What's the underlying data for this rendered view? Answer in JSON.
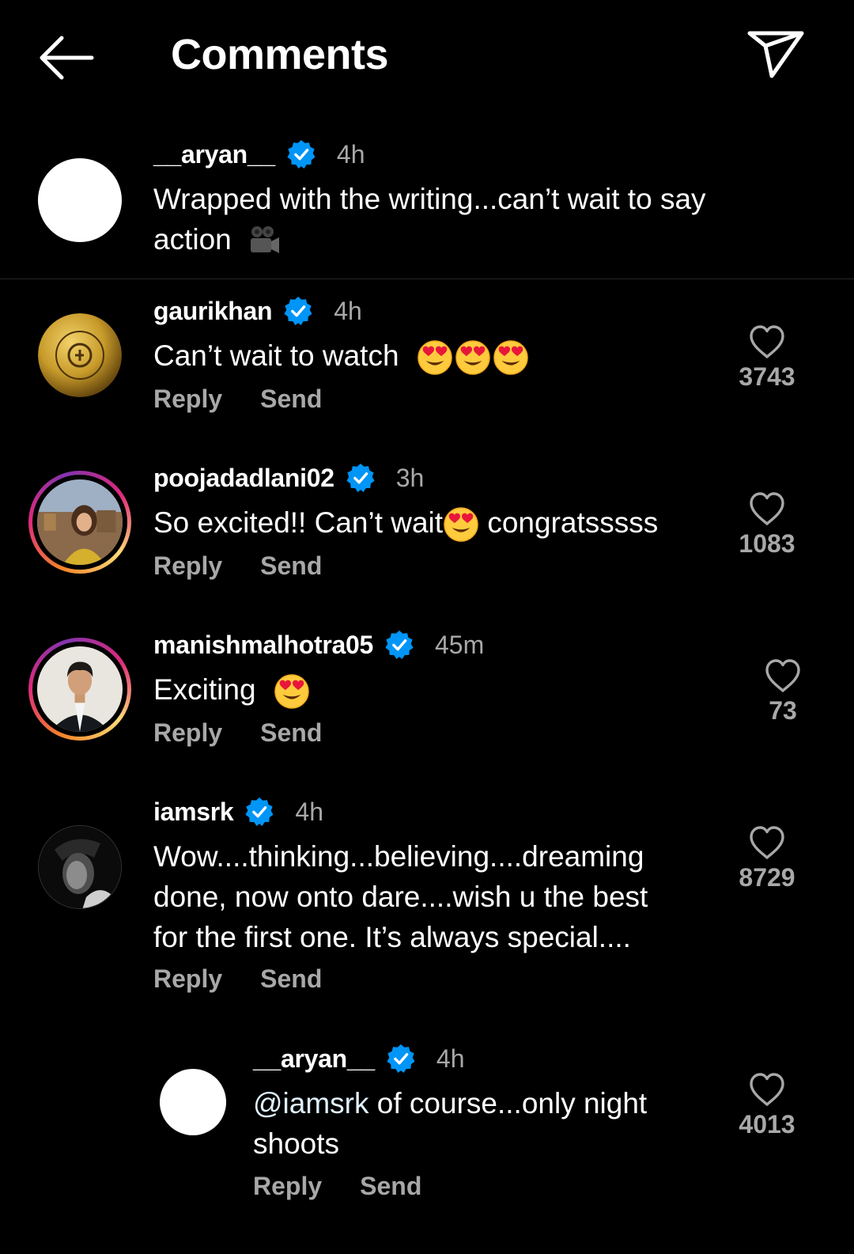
{
  "header": {
    "title": "Comments"
  },
  "caption": {
    "username": "__aryan__",
    "time": "4h",
    "text_line1": "Wrapped with the writing...can’t wait to say",
    "text_line2": "action"
  },
  "comments": [
    {
      "username": "gaurikhan",
      "time": "4h",
      "text": "Can’t wait to watch",
      "reply_label": "Reply",
      "send_label": "Send",
      "likes": "3743"
    },
    {
      "username": "poojadadlani02",
      "time": "3h",
      "text_before": "So excited!! Can’t wait",
      "text_after": " congratsssss",
      "reply_label": "Reply",
      "send_label": "Send",
      "likes": "1083"
    },
    {
      "username": "manishmalhotra05",
      "time": "45m",
      "text": "Exciting",
      "reply_label": "Reply",
      "send_label": "Send",
      "likes": "73"
    },
    {
      "username": "iamsrk",
      "time": "4h",
      "text_line1": "Wow....thinking...believing....dreaming",
      "text_line2": "done, now onto dare....wish u the best",
      "text_line3": "for the first one. It’s always special....",
      "reply_label": "Reply",
      "send_label": "Send",
      "likes": "8729"
    },
    {
      "username": "__aryan__",
      "time": "4h",
      "mention": "@iamsrk",
      "text_rest": " of course...only night",
      "text_line2": "shoots",
      "reply_label": "Reply",
      "send_label": "Send",
      "likes": "4013"
    }
  ],
  "icons": {
    "back": "arrow-left-icon",
    "send": "paper-plane-icon",
    "verified": "verified-badge-icon",
    "like": "heart-outline-icon",
    "emoji_heart_eyes": "heart-eyes-emoji",
    "emoji_camera": "movie-camera-emoji"
  },
  "colors": {
    "background": "#000000",
    "verified": "#0095f6",
    "secondary_text": "#a8a8a8"
  }
}
